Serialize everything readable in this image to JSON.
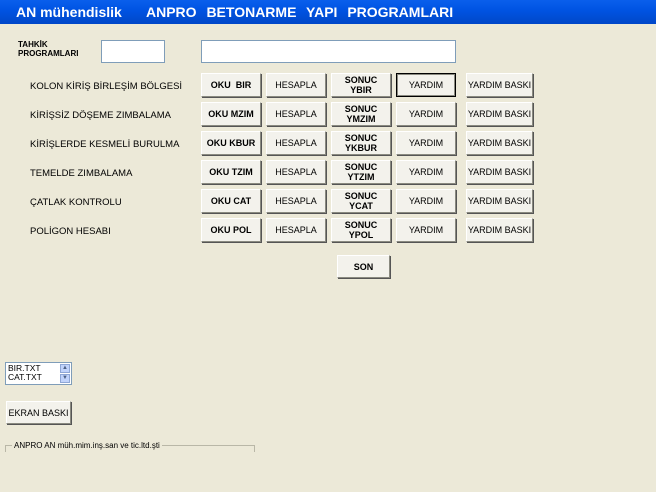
{
  "title": {
    "app": "AN mühendislik",
    "program": "ANPRO  BETONARME  YAPI  PROGRAMLARI"
  },
  "tahkik_label": "TAHKİK\nPROGRAMLARI",
  "inputs": {
    "small_value": "",
    "wide_value": ""
  },
  "rows": [
    {
      "label": "KOLON KİRİŞ BİRLEŞİM BÖLGESİ",
      "oku": "OKU  BIR",
      "hesapla": "HESAPLA",
      "sonuc": "SONUC\nYBIR",
      "yardim": "YARDIM",
      "baski": "YARDIM BASKI"
    },
    {
      "label": "KİRİŞSİZ DÖŞEME  ZIMBALAMA",
      "oku": "OKU MZIM",
      "hesapla": "HESAPLA",
      "sonuc": "SONUC\nYMZIM",
      "yardim": "YARDIM",
      "baski": "YARDIM BASKI"
    },
    {
      "label": "KİRİŞLERDE KESMELİ  BURULMA",
      "oku": "OKU KBUR",
      "hesapla": "HESAPLA",
      "sonuc": "SONUC\nYKBUR",
      "yardim": "YARDIM",
      "baski": "YARDIM BASKI"
    },
    {
      "label": "TEMELDE ZIMBALAMA",
      "oku": "OKU TZIM",
      "hesapla": "HESAPLA",
      "sonuc": "SONUC\nYTZIM",
      "yardim": "YARDIM",
      "baski": "YARDIM BASKI"
    },
    {
      "label": "ÇATLAK KONTROLU",
      "oku": "OKU CAT",
      "hesapla": "HESAPLA",
      "sonuc": "SONUC\nYCAT",
      "yardim": "YARDIM",
      "baski": "YARDIM BASKI"
    },
    {
      "label": "POLİGON HESABI",
      "oku": "OKU POL",
      "hesapla": "HESAPLA",
      "sonuc": "SONUC\nYPOL",
      "yardim": "YARDIM",
      "baski": "YARDIM BASKI"
    }
  ],
  "son_button": "SON",
  "file_list": [
    "BIR.TXT",
    "CAT.TXT"
  ],
  "scroll_icons": {
    "up": "scroll-up-arrow",
    "down": "scroll-down-arrow"
  },
  "ekran_baski": "EKRAN BASKI",
  "status_text": "ANPRO    AN müh.mim.inş.san ve tic.ltd.şti",
  "colors": {
    "titlebar": "#0054E3",
    "window": "#ECE9D8",
    "button": "#F3F2EC"
  }
}
